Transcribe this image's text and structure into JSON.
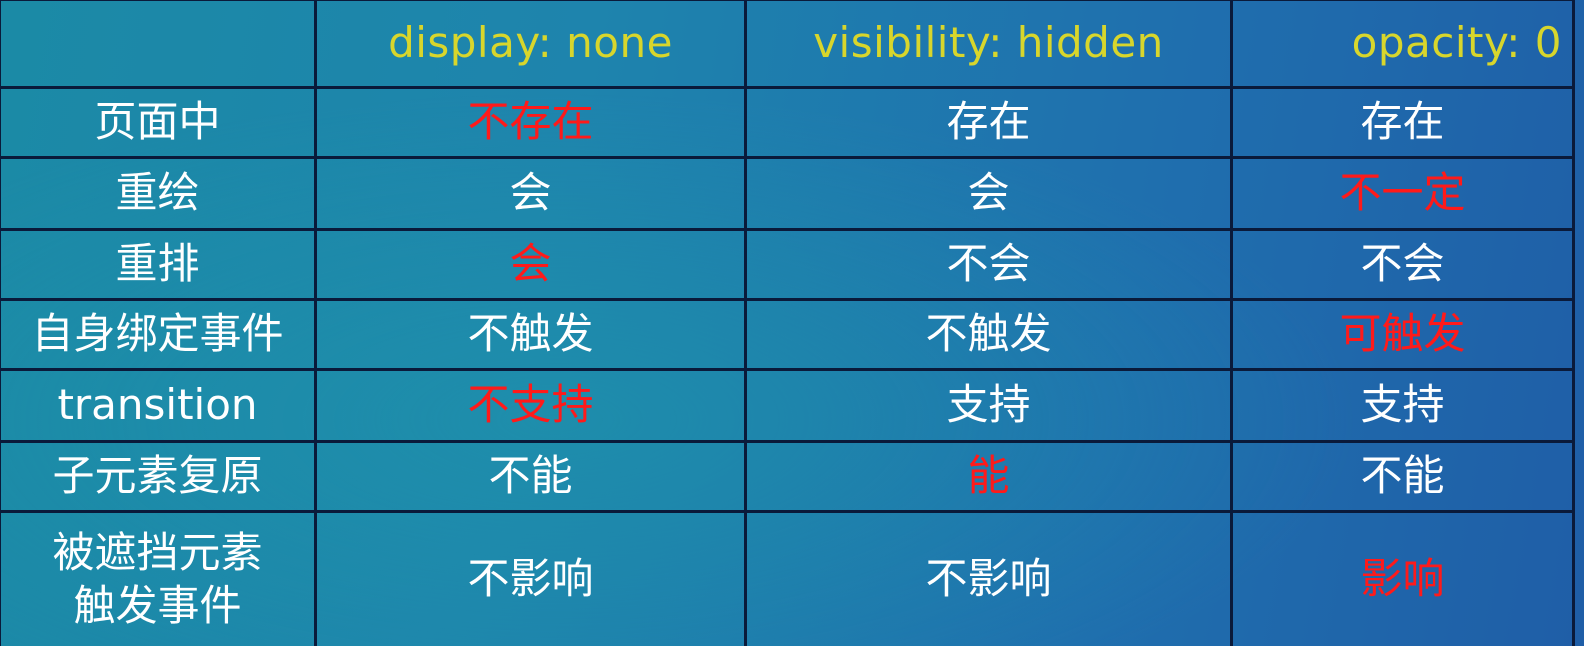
{
  "colors": {
    "header_text": "#d8d62c",
    "normal_text": "#ffffff",
    "highlight_text": "#ff1a1a",
    "grid_line": "#0a1a3a"
  },
  "header": [
    "",
    "display: none",
    "visibility: hidden",
    "opacity: 0"
  ],
  "rows": [
    {
      "label": "页面中",
      "cells": [
        {
          "text": "不存在",
          "highlight": true
        },
        {
          "text": "存在",
          "highlight": false
        },
        {
          "text": "存在",
          "highlight": false
        }
      ]
    },
    {
      "label": "重绘",
      "cells": [
        {
          "text": "会",
          "highlight": false
        },
        {
          "text": "会",
          "highlight": false
        },
        {
          "text": "不一定",
          "highlight": true
        }
      ]
    },
    {
      "label": "重排",
      "cells": [
        {
          "text": "会",
          "highlight": true
        },
        {
          "text": "不会",
          "highlight": false
        },
        {
          "text": "不会",
          "highlight": false
        }
      ]
    },
    {
      "label": "自身绑定事件",
      "cells": [
        {
          "text": "不触发",
          "highlight": false
        },
        {
          "text": "不触发",
          "highlight": false
        },
        {
          "text": "可触发",
          "highlight": true
        }
      ]
    },
    {
      "label": "transition",
      "cells": [
        {
          "text": "不支持",
          "highlight": true
        },
        {
          "text": "支持",
          "highlight": false
        },
        {
          "text": "支持",
          "highlight": false
        }
      ]
    },
    {
      "label": "子元素复原",
      "cells": [
        {
          "text": "不能",
          "highlight": false
        },
        {
          "text": "能",
          "highlight": true
        },
        {
          "text": "不能",
          "highlight": false
        }
      ]
    },
    {
      "label_lines": [
        "被遮挡元素",
        "触发事件"
      ],
      "cells": [
        {
          "text": "不影响",
          "highlight": false
        },
        {
          "text": "不影响",
          "highlight": false
        },
        {
          "text": "影响",
          "highlight": true
        }
      ]
    }
  ]
}
